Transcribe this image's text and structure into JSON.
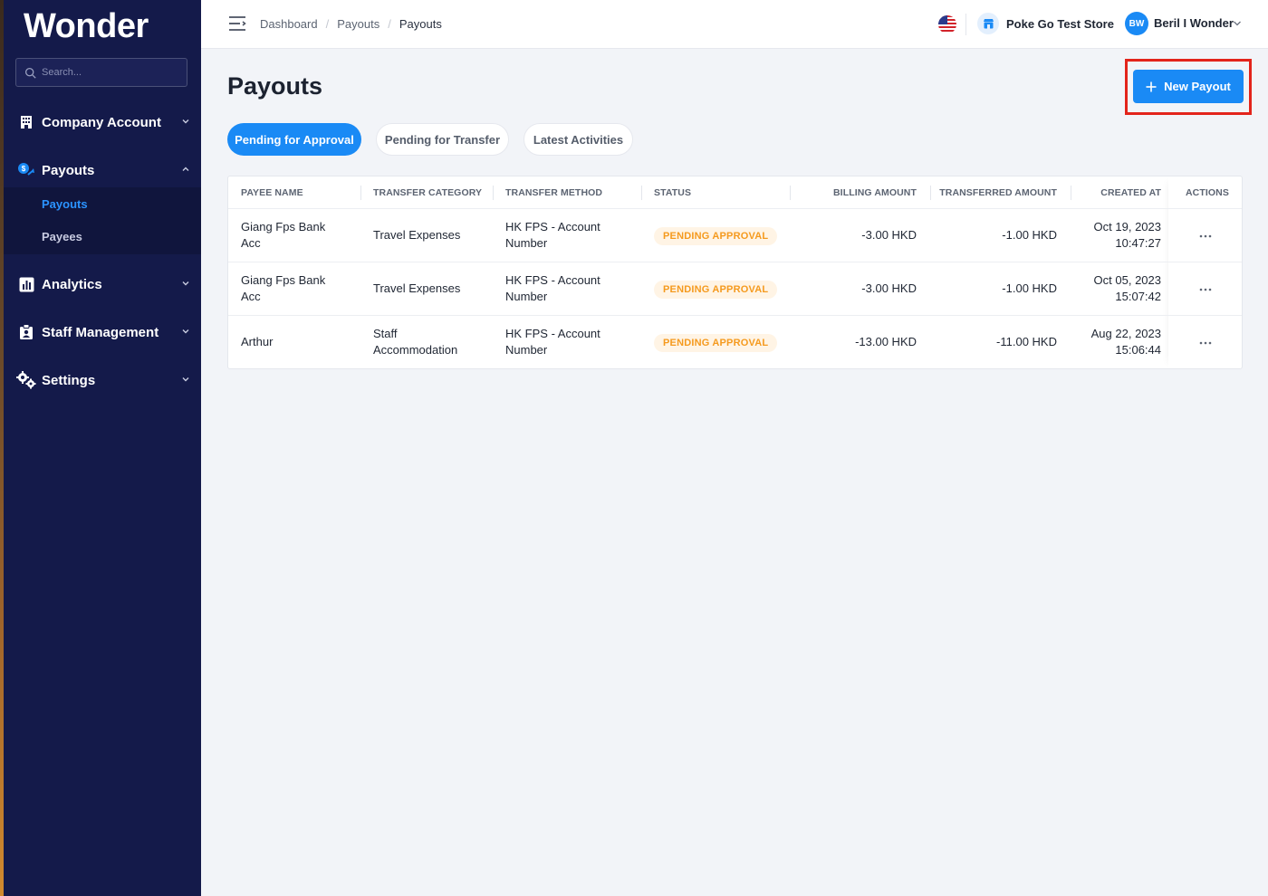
{
  "brand": {
    "logo": "Wonder"
  },
  "search": {
    "placeholder": "Search..."
  },
  "sidebar": {
    "items": [
      {
        "label": "Company Account"
      },
      {
        "label": "Payouts"
      },
      {
        "label": "Analytics"
      },
      {
        "label": "Staff Management"
      },
      {
        "label": "Settings"
      }
    ],
    "sub_items": [
      {
        "label": "Payouts",
        "active": true
      },
      {
        "label": "Payees",
        "active": false
      }
    ]
  },
  "topbar": {
    "breadcrumb": [
      "Dashboard",
      "Payouts",
      "Payouts"
    ],
    "store_name": "Poke Go Test Store",
    "user_initials": "BW",
    "user_name": "Beril I Wonder"
  },
  "page": {
    "title": "Payouts",
    "new_button": "New Payout",
    "tabs": [
      {
        "label": "Pending for Approval",
        "active": true
      },
      {
        "label": "Pending for Transfer",
        "active": false
      },
      {
        "label": "Latest Activities",
        "active": false
      }
    ]
  },
  "table": {
    "columns": [
      "PAYEE NAME",
      "TRANSFER CATEGORY",
      "TRANSFER METHOD",
      "STATUS",
      "BILLING AMOUNT",
      "TRANSFERRED AMOUNT",
      "CREATED AT",
      "ACTIONS"
    ],
    "rows": [
      {
        "payee": [
          "Giang Fps Bank",
          "Acc"
        ],
        "category": [
          "Travel Expenses"
        ],
        "method": [
          "HK FPS - Account",
          "Number"
        ],
        "status": "PENDING APPROVAL",
        "billing": "-3.00 HKD",
        "transferred": "-1.00 HKD",
        "created": [
          "Oct 19, 2023",
          "10:47:27"
        ]
      },
      {
        "payee": [
          "Giang Fps Bank",
          "Acc"
        ],
        "category": [
          "Travel Expenses"
        ],
        "method": [
          "HK FPS - Account",
          "Number"
        ],
        "status": "PENDING APPROVAL",
        "billing": "-3.00 HKD",
        "transferred": "-1.00 HKD",
        "created": [
          "Oct 05, 2023",
          "15:07:42"
        ]
      },
      {
        "payee": [
          "Arthur"
        ],
        "category": [
          "Staff",
          "Accommodation"
        ],
        "method": [
          "HK FPS - Account",
          "Number"
        ],
        "status": "PENDING APPROVAL",
        "billing": "-13.00 HKD",
        "transferred": "-11.00 HKD",
        "created": [
          "Aug 22, 2023",
          "15:06:44"
        ]
      }
    ]
  },
  "colors": {
    "accent": "#1a8af5",
    "sidebar": "#141a4a",
    "badge_text": "#f59a1e",
    "highlight": "#e3241b"
  }
}
